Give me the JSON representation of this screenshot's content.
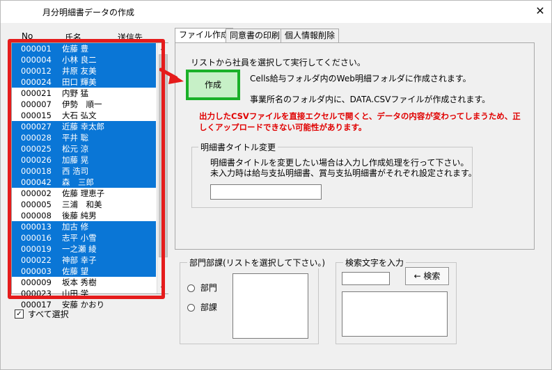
{
  "window": {
    "title": "月分明細書データの作成",
    "close": "✕"
  },
  "list": {
    "headers": {
      "no": "No",
      "name": "氏名",
      "dest": "送信先"
    },
    "rows": [
      {
        "no": "000001",
        "name": "佐藤 豊",
        "selected": true
      },
      {
        "no": "000004",
        "name": "小林 良二",
        "selected": true
      },
      {
        "no": "000012",
        "name": "井原 友美",
        "selected": true
      },
      {
        "no": "000024",
        "name": "田口 輝美",
        "selected": true
      },
      {
        "no": "000021",
        "name": "内野 猛",
        "selected": false
      },
      {
        "no": "000007",
        "name": "伊勢　順一",
        "selected": false
      },
      {
        "no": "000015",
        "name": "大石 弘文",
        "selected": false
      },
      {
        "no": "000027",
        "name": "近藤 幸太郎",
        "selected": true
      },
      {
        "no": "000028",
        "name": "平井 聡",
        "selected": true
      },
      {
        "no": "000025",
        "name": "松元 涼",
        "selected": true
      },
      {
        "no": "000026",
        "name": "加藤 晃",
        "selected": true
      },
      {
        "no": "000018",
        "name": "西 浩司",
        "selected": true
      },
      {
        "no": "000042",
        "name": "森　三郎",
        "selected": true
      },
      {
        "no": "000002",
        "name": "佐藤 理恵子",
        "selected": false
      },
      {
        "no": "000005",
        "name": "三浦　和美",
        "selected": false
      },
      {
        "no": "000008",
        "name": "後藤 純男",
        "selected": false
      },
      {
        "no": "000013",
        "name": "加古 修",
        "selected": true
      },
      {
        "no": "000016",
        "name": "志平 小雪",
        "selected": true
      },
      {
        "no": "000019",
        "name": "一之瀬 綾",
        "selected": true
      },
      {
        "no": "000022",
        "name": "神部 幸子",
        "selected": true
      },
      {
        "no": "000003",
        "name": "佐藤 望",
        "selected": true
      },
      {
        "no": "000009",
        "name": "坂本 秀樹",
        "selected": false
      },
      {
        "no": "000023",
        "name": "山田 学",
        "selected": false
      },
      {
        "no": "000017",
        "name": "安藤 かおり",
        "selected": false
      }
    ]
  },
  "select_all": {
    "label": "すべて選択",
    "checked": "✓"
  },
  "tabs": [
    {
      "label": "ファイル作成"
    },
    {
      "label": "同意書の印刷"
    },
    {
      "label": "個人情報削除"
    }
  ],
  "file_tab": {
    "instruction": "リストから社員を選択して実行してください。",
    "create_button": "作成",
    "info1": "Cells給与フォルダ内のWeb明細フォルダに作成されます。",
    "info2": "事業所名のフォルダ内に、DATA.CSVファイルが作成されます。",
    "warning": "出力したCSVファイルを直接エクセルで開くと、データの内容が変わってしまうため、正しくアップロードできない可能性があります。",
    "title_group": {
      "caption": "明細書タイトル変更",
      "line1": "明細書タイトルを変更したい場合は入力し作成処理を行って下さい。",
      "line2": "未入力時は給与支払明細書、賞与支払明細書がそれぞれ設定されます。",
      "value": ""
    }
  },
  "dept_group": {
    "caption": "部門部課(リストを選択して下さい。)",
    "opt1": "部門",
    "opt2": "部課"
  },
  "search_group": {
    "caption": "検索文字を入力",
    "button": "← 検索",
    "value": ""
  },
  "colors": {
    "selection": "#0a76d6",
    "highlight_red": "#e51c1c",
    "create_green": "#1ab028",
    "warning": "#e00000"
  }
}
